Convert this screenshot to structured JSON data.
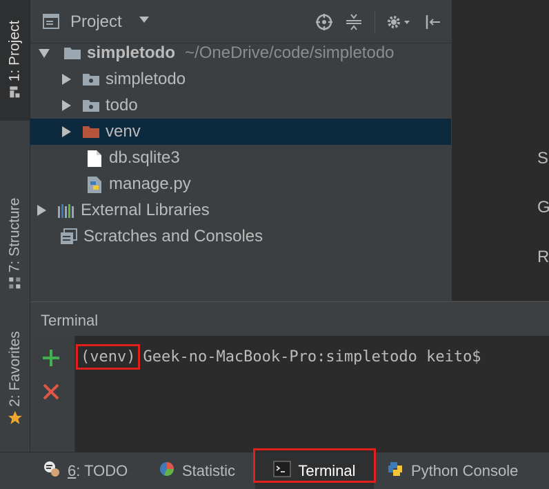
{
  "left_strip": {
    "project_tab": "1: Project",
    "structure_tab": "7: Structure",
    "favorites_tab": "2: Favorites"
  },
  "project_panel": {
    "title": "Project",
    "tree": [
      {
        "label": "simpletodo",
        "path": "~/OneDrive/code/simpletodo",
        "icon": "folder-icon",
        "expanded": true
      },
      {
        "label": "simpletodo",
        "icon": "package-folder-icon"
      },
      {
        "label": "todo",
        "icon": "package-folder-icon"
      },
      {
        "label": "venv",
        "icon": "excluded-folder-icon",
        "selected": true
      },
      {
        "label": "db.sqlite3",
        "icon": "file-icon"
      },
      {
        "label": "manage.py",
        "icon": "python-file-icon"
      },
      {
        "label": "External Libraries",
        "icon": "libraries-icon"
      },
      {
        "label": "Scratches and Consoles",
        "icon": "scratches-icon"
      }
    ]
  },
  "editor": {
    "letters": [
      "S",
      "G",
      "R"
    ]
  },
  "terminal": {
    "title": "Terminal",
    "venv": "(venv)",
    "prompt": "Geek-no-MacBook-Pro:simpletodo keito$"
  },
  "bottom_bar": {
    "todo_prefix": "6",
    "todo_rest": ": TODO",
    "statistic": "Statistic",
    "terminal": "Terminal",
    "python_console": "Python Console"
  },
  "colors": {
    "accent_red": "#e0201a",
    "selection": "#0d293e",
    "add_green": "#3fb24f",
    "close_red": "#e0574a"
  }
}
